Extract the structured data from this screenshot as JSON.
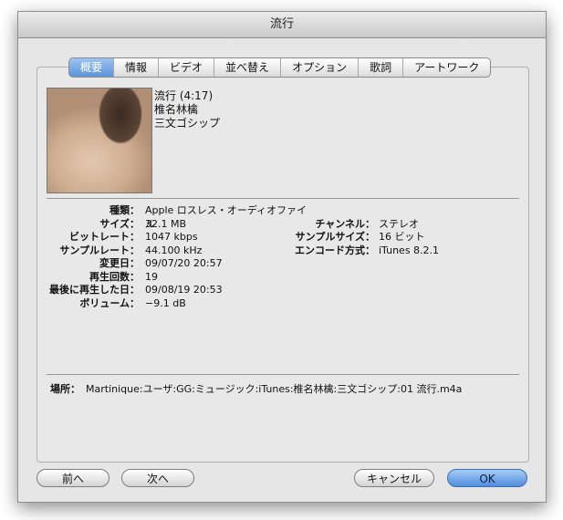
{
  "window": {
    "title": "流行"
  },
  "tabs": [
    {
      "label": "概要",
      "active": true
    },
    {
      "label": "情報",
      "active": false
    },
    {
      "label": "ビデオ",
      "active": false
    },
    {
      "label": "並べ替え",
      "active": false
    },
    {
      "label": "オプション",
      "active": false
    },
    {
      "label": "歌詞",
      "active": false
    },
    {
      "label": "アートワーク",
      "active": false
    }
  ],
  "summary": {
    "title_line": "流行 (4:17)",
    "artist": "椎名林檎",
    "album": "三文ゴシップ"
  },
  "details_left": [
    {
      "label": "種類：",
      "value": "Apple ロスレス・オーディオファイル"
    },
    {
      "label": "サイズ：",
      "value": "32.1 MB"
    },
    {
      "label": "ビットレート：",
      "value": "1047 kbps"
    },
    {
      "label": "サンプルレート：",
      "value": "44.100 kHz"
    },
    {
      "label": "変更日：",
      "value": "09/07/20 20:57"
    },
    {
      "label": "再生回数：",
      "value": "19"
    },
    {
      "label": "最後に再生した日：",
      "value": "09/08/19 20:53"
    },
    {
      "label": "ボリューム：",
      "value": "−9.1 dB"
    }
  ],
  "details_right": [
    {
      "label": "チャンネル：",
      "value": "ステレオ"
    },
    {
      "label": "サンプルサイズ：",
      "value": "16 ビット"
    },
    {
      "label": "エンコード方式：",
      "value": "iTunes 8.2.1"
    }
  ],
  "location": {
    "label": "場所：",
    "path": "Martinique:ユーザ:GG:ミュージック:iTunes:椎名林檎:三文ゴシップ:01 流行.m4a"
  },
  "buttons": {
    "prev": "前へ",
    "next": "次へ",
    "cancel": "キャンセル",
    "ok": "OK"
  },
  "colors": {
    "accent": "#5c93d8",
    "window_bg": "#e6e6e6"
  }
}
